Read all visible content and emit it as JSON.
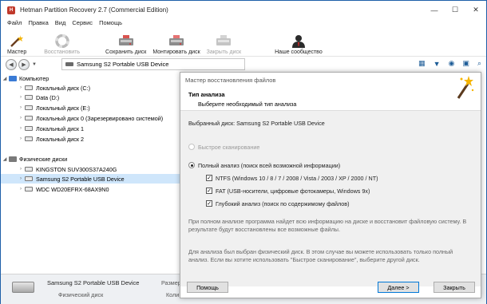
{
  "app": {
    "title": "Hetman Partition Recovery 2.7 (Commercial Edition)"
  },
  "window_controls": {
    "minimize": "—",
    "maximize": "☐",
    "close": "✕"
  },
  "menu": [
    "Файл",
    "Правка",
    "Вид",
    "Сервис",
    "Помощь"
  ],
  "toolbar": {
    "wizard": "Мастер",
    "restore": "Восстановить",
    "save_disk": "Сохранить диск",
    "mount_disk": "Монтировать диск",
    "close_disk": "Закрыть диск",
    "community": "Наше сообщество"
  },
  "address": {
    "path": "Samsung S2 Portable USB Device"
  },
  "tree": {
    "computer": "Компьютер",
    "drives": [
      "Локальный диск (C:)",
      "Data (D:)",
      "Локальный диск (E:)",
      "Локальный диск 0 (Зарезервировано системой)",
      "Локальный диск 1",
      "Локальный диск 2"
    ],
    "physical": "Физические диски",
    "physical_drives": [
      "KINGSTON SUV300S37A240G",
      "Samsung S2 Portable USB Device",
      "WDC WD20EFRX-68AX9N0"
    ]
  },
  "status": {
    "device": "Samsung S2 Portable USB Device",
    "type": "Физический диск",
    "size_label": "Размер",
    "count_label": "Коли"
  },
  "dialog": {
    "title": "Мастер восстановления файлов",
    "heading": "Тип анализа",
    "subheading": "Выберите необходимый тип анализа",
    "selected_disk": "Выбранный диск: Samsung S2 Portable USB Device",
    "quick_scan": "Быстрое сканирование",
    "full_analysis": "Полный анализ (поиск всей возможной информации)",
    "ntfs": "NTFS (Windows 10 / 8 / 7 / 2008 / Vista / 2003 / XP / 2000 / NT)",
    "fat": "FAT (USB-носители, цифровые фотокамеры, Windows 9x)",
    "deep": "Глубокий анализ (поиск по содержимому файлов)",
    "note1": "При полном анализе программа найдет всю информацию на диске и восстановит файловую систему. В результате будут восстановлены все возможные файлы.",
    "note2": "Для анализа был выбран физический диск. В этом случае вы можете использовать только полный анализ. Если вы хотите использовать \"Быстрое сканирование\", выберите другой диск.",
    "help": "Помощь",
    "next": "Далее >",
    "close": "Закрыть"
  }
}
